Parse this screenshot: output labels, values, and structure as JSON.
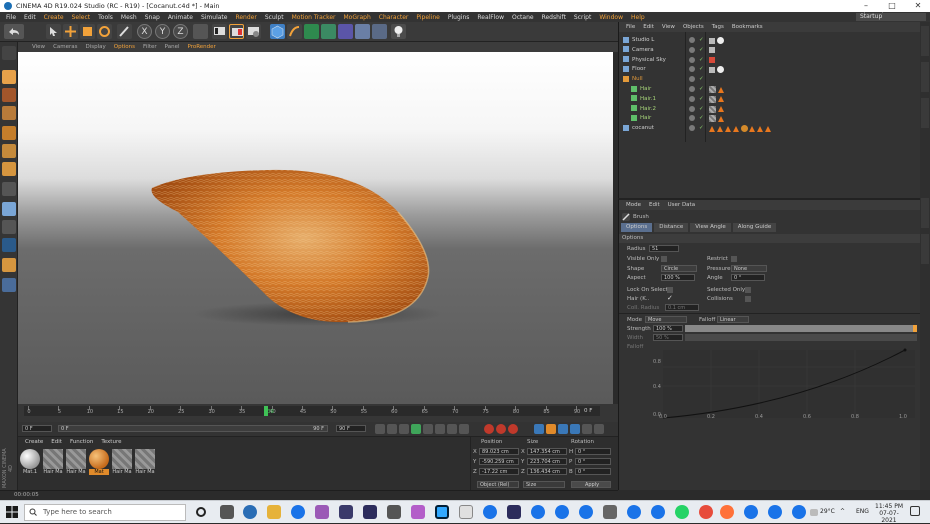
{
  "window": {
    "title": "CINEMA 4D R19.024 Studio (RC - R19) - [Cocanut.c4d *] - Main"
  },
  "menu": {
    "items": [
      "File",
      "Edit",
      "Create",
      "Select",
      "Tools",
      "Mesh",
      "Snap",
      "Animate",
      "Simulate",
      "Render",
      "Sculpt",
      "Motion Tracker",
      "MoGraph",
      "Character",
      "Pipeline",
      "Plugins",
      "RealFlow",
      "Octane",
      "Redshift",
      "Script",
      "Window",
      "Help"
    ],
    "highlighted": [
      "Create",
      "Select",
      "Render",
      "Motion Tracker",
      "MoGraph",
      "Character",
      "Pipeline",
      "Window",
      "Help"
    ],
    "layout_label": "Layout:",
    "layout_value": "Startup"
  },
  "toolbar": {
    "axis_x": "X",
    "axis_y": "Y",
    "axis_z": "Z"
  },
  "viewport": {
    "menu": [
      "View",
      "Cameras",
      "Display",
      "Options",
      "Filter",
      "Panel",
      "ProRender"
    ],
    "highlighted": [
      "Options",
      "ProRender"
    ]
  },
  "timeline": {
    "ticks": [
      "0",
      "5",
      "10",
      "15",
      "20",
      "25",
      "30",
      "35",
      "40",
      "45",
      "50",
      "55",
      "60",
      "65",
      "70",
      "75",
      "80",
      "85",
      "90"
    ],
    "current_frame": "39",
    "end_label": "0 F",
    "start_field": "0 F",
    "range_start": "0 F",
    "range_end": "90 F",
    "max_field": "90 F"
  },
  "materials": {
    "menu": [
      "Create",
      "Edit",
      "Function",
      "Texture"
    ],
    "items": [
      "Mat.1",
      "Hair Ma",
      "Hair Ma",
      "Mat",
      "Hair Ma",
      "Hair Ma"
    ],
    "brand": "MAXON CINEMA 4D"
  },
  "coordinates": {
    "headers": [
      "Position",
      "Size",
      "Rotation"
    ],
    "rows": [
      {
        "axis": "X",
        "pos": "89.023 cm",
        "size_axis": "X",
        "size": "147.354 cm",
        "rot_axis": "H",
        "rot": "0 °"
      },
      {
        "axis": "Y",
        "pos": "-590.259 cm",
        "size_axis": "Y",
        "size": "223.704 cm",
        "rot_axis": "P",
        "rot": "0 °"
      },
      {
        "axis": "Z",
        "pos": "-17.22 cm",
        "size_axis": "Z",
        "size": "136.434 cm",
        "rot_axis": "B",
        "rot": "0 °"
      }
    ],
    "mode_select": "Object (Rel)",
    "size_select": "Size",
    "apply_label": "Apply"
  },
  "status": {
    "time": "00:00:05"
  },
  "object_manager": {
    "menu": [
      "File",
      "Edit",
      "View",
      "Objects",
      "Tags",
      "Bookmarks"
    ],
    "objects": [
      {
        "name": "Studio L",
        "color": "#cfcfcf"
      },
      {
        "name": "Camera",
        "color": "#cfcfcf"
      },
      {
        "name": "Physical Sky",
        "color": "#cfcfcf"
      },
      {
        "name": "Floor",
        "color": "#cfcfcf"
      },
      {
        "name": "Null",
        "color": "#e39a3a"
      },
      {
        "name": "Hair",
        "color": "#a8d67a"
      },
      {
        "name": "Hair.1",
        "color": "#a8d67a"
      },
      {
        "name": "Hair.2",
        "color": "#a8d67a"
      },
      {
        "name": "Hair",
        "color": "#a8d67a"
      },
      {
        "name": "cocanut",
        "color": "#cfcfcf"
      }
    ]
  },
  "attributes": {
    "menu": [
      "Mode",
      "Edit",
      "User Data"
    ],
    "tool_name": "Brush",
    "tabs": [
      "Options",
      "Distance",
      "View Angle",
      "Along Guide"
    ],
    "section": "Options",
    "radius_label": "Radius",
    "radius_value": "51",
    "visible_only": "Visible Only",
    "restrict": "Restrict",
    "shape_label": "Shape",
    "shape_value": "Circle",
    "pressure_label": "Pressure",
    "pressure_value": "None",
    "aspect_label": "Aspect",
    "aspect_value": "100 %",
    "angle_label": "Angle",
    "angle_value": "0 °",
    "lock_on_select": "Lock On Select",
    "selected_only": "Selected Only",
    "hair_k": "Hair (K..",
    "collisions": "Collisions",
    "coll_radius_label": "Coll. Radius",
    "coll_radius_value": "0.1 cm",
    "mode_label": "Mode",
    "mode_value": "Move",
    "falloff_label": "Falloff",
    "falloff_value": "Linear",
    "strength_label": "Strength",
    "strength_value": "100 %",
    "strength_fraction": 1.0,
    "width_label": "Width",
    "width_value": "50 %",
    "falloff_graph_label": "Falloff",
    "graph_y_ticks": [
      "0.8",
      "0.4",
      "0.0"
    ],
    "graph_x_ticks": [
      "0.0",
      "0.2",
      "0.4",
      "0.6",
      "0.8",
      "1.0"
    ]
  },
  "taskbar": {
    "search_placeholder": "Type here to search",
    "temperature": "29°C",
    "language": "ENG",
    "time": "11:45 PM",
    "date": "07-07-2021"
  }
}
